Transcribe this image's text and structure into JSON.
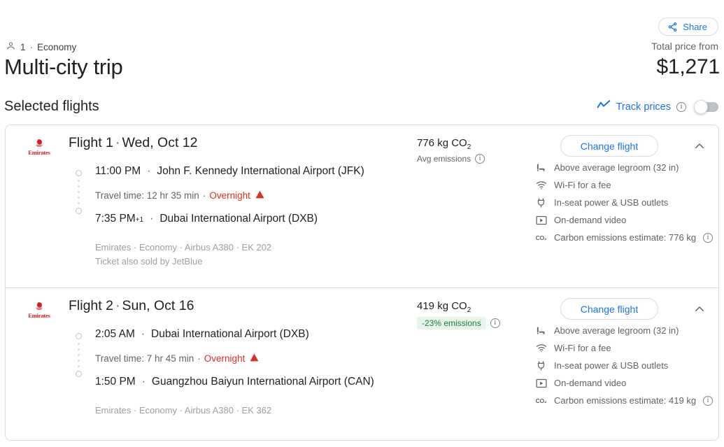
{
  "header": {
    "share_label": "Share",
    "share_icon": "share-icon",
    "passenger_icon": "person-icon",
    "passengers": "1",
    "separator": "·",
    "cabin": "Economy",
    "title": "Multi-city trip",
    "total_price_label": "Total price from",
    "total_price": "$1,271",
    "selected_flights_label": "Selected flights",
    "track_prices_label": "Track prices",
    "track_prices_icon": "trending-line-icon",
    "track_prices_info_icon": "info-icon",
    "track_prices_toggle_state": "off"
  },
  "colors": {
    "accent_blue": "#1a73e8",
    "text_primary": "#202124",
    "text_secondary": "#5f6368",
    "text_muted": "#9aa0a6",
    "border": "#dadce0",
    "warning_red": "#d93025",
    "emirates_red": "#d71a21",
    "badge_bg": "#e6f4ea",
    "badge_text": "#188038"
  },
  "legs": [
    {
      "airline_logo": "emirates-logo",
      "airline_wordmark": "Emirates",
      "title_main": "Flight 1",
      "title_sep": "·",
      "title_date": "Wed, Oct 12",
      "co2_value": "776 kg CO",
      "co2_subscript": "2",
      "co2_note": "Avg emissions",
      "co2_badge": null,
      "co2_info_icon": "info-icon",
      "change_flight_label": "Change flight",
      "collapse_icon": "chevron-up-icon",
      "depart_time": "11:00 PM",
      "depart_day_offset": "",
      "depart_airport": "John F. Kennedy International Airport (JFK)",
      "travel_time_label": "Travel time: 12 hr 35 min",
      "travel_sep": "·",
      "overnight_label": "Overnight",
      "overnight_icon": "warning-triangle-icon",
      "arrive_time": "7:35 PM",
      "arrive_day_offset": "+1",
      "arrive_airport": "Dubai International Airport (DXB)",
      "meta_line1": "Emirates · Economy · Airbus A380 · EK 202",
      "meta_line2": "Ticket also sold by JetBlue",
      "amenities": [
        {
          "icon": "legroom-icon",
          "label": "Above average legroom (32 in)",
          "info": false
        },
        {
          "icon": "wifi-icon",
          "label": "Wi-Fi for a fee",
          "info": false
        },
        {
          "icon": "power-outlet-icon",
          "label": "In-seat power & USB outlets",
          "info": false
        },
        {
          "icon": "video-icon",
          "label": "On-demand video",
          "info": false
        },
        {
          "icon": "co2-icon",
          "label": "Carbon emissions estimate: 776 kg",
          "info": true
        }
      ]
    },
    {
      "airline_logo": "emirates-logo",
      "airline_wordmark": "Emirates",
      "title_main": "Flight 2",
      "title_sep": "·",
      "title_date": "Sun, Oct 16",
      "co2_value": "419 kg CO",
      "co2_subscript": "2",
      "co2_note": null,
      "co2_badge": "-23% emissions",
      "co2_info_icon": "info-icon",
      "change_flight_label": "Change flight",
      "collapse_icon": "chevron-up-icon",
      "depart_time": "2:05 AM",
      "depart_day_offset": "",
      "depart_airport": "Dubai International Airport (DXB)",
      "travel_time_label": "Travel time: 7 hr 45 min",
      "travel_sep": "·",
      "overnight_label": "Overnight",
      "overnight_icon": "warning-triangle-icon",
      "arrive_time": "1:50 PM",
      "arrive_day_offset": "",
      "arrive_airport": "Guangzhou Baiyun International Airport (CAN)",
      "meta_line1": "Emirates · Economy · Airbus A380 · EK 362",
      "meta_line2": null,
      "amenities": [
        {
          "icon": "legroom-icon",
          "label": "Above average legroom (32 in)",
          "info": false
        },
        {
          "icon": "wifi-icon",
          "label": "Wi-Fi for a fee",
          "info": false
        },
        {
          "icon": "power-outlet-icon",
          "label": "In-seat power & USB outlets",
          "info": false
        },
        {
          "icon": "video-icon",
          "label": "On-demand video",
          "info": false
        },
        {
          "icon": "co2-icon",
          "label": "Carbon emissions estimate: 419 kg",
          "info": true
        }
      ]
    }
  ]
}
